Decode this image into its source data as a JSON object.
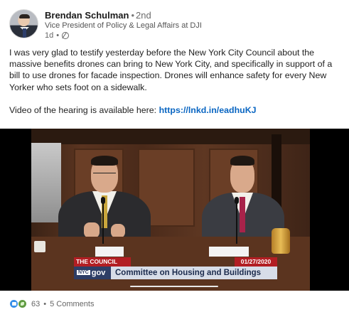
{
  "author": {
    "name": "Brendan Schulman",
    "separator": "•",
    "degree": "2nd",
    "headline": "Vice President of Policy & Legal Affairs at DJI",
    "time": "1d",
    "time_separator": "•",
    "visibility_icon": "globe-icon"
  },
  "post": {
    "paragraph1": "I was very glad to testify yesterday before the New York City Council about the massive benefits drones can bring to New York City, and specifically in support of a bill to use drones for facade inspection. Drones will enhance safety for every New Yorker who sets foot on a sidewalk.",
    "paragraph2_prefix": "Video of the hearing is available here: ",
    "link": "https://lnkd.in/eadhuKJ"
  },
  "video": {
    "channel_label": "THE COUNCIL",
    "date": "01/27/2020",
    "logo_small": "NYC",
    "logo_text": "gov",
    "caption": "Committee on Housing and Buildings",
    "progress_fraction": 0.0
  },
  "social": {
    "reaction_icons": [
      "like-icon",
      "celebrate-icon"
    ],
    "reaction_count": "63",
    "separator": "•",
    "comments": "5 Comments"
  },
  "colors": {
    "link": "#0a66c2",
    "council_red": "#b21e23",
    "caption_bg": "#d7dde8",
    "like_blue": "#378fe9"
  }
}
